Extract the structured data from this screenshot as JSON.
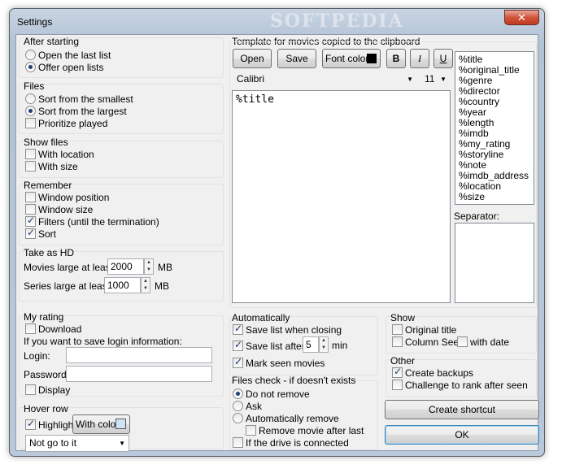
{
  "window": {
    "title": "Settings",
    "watermark": "SOFTPEDIA",
    "close_label": "✕"
  },
  "after_starting": {
    "title": "After starting",
    "options": [
      "Open the last list",
      "Offer open lists"
    ],
    "selected": "Offer open lists"
  },
  "files": {
    "title": "Files",
    "sort_smallest": "Sort from the smallest",
    "sort_largest": "Sort from the largest",
    "prioritize": "Prioritize played"
  },
  "show_files": {
    "title": "Show files",
    "with_location": "With location",
    "with_size": "With size"
  },
  "remember": {
    "title": "Remember",
    "window_position": "Window position",
    "window_size": "Window size",
    "filters": "Filters (until the termination)",
    "sort": "Sort"
  },
  "take_as_hd": {
    "title": "Take as HD",
    "movies_label": "Movies large at least",
    "movies_value": "2000",
    "movies_unit": "MB",
    "series_label": "Series large at least",
    "series_value": "1000",
    "series_unit": "MB"
  },
  "my_rating": {
    "title": "My rating",
    "download": "Download",
    "save_login_info": "If you want to save login information:",
    "login_label": "Login:",
    "login_value": "",
    "password_label": "Password:",
    "password_value": "",
    "display": "Display"
  },
  "hover_row": {
    "title": "Hover row",
    "highlight": "Highlight",
    "with_color": "With color",
    "select_value": "Not go to it"
  },
  "template": {
    "title": "Template for movies copied to the clipboard",
    "open_button": "Open",
    "save_button": "Save",
    "font_color_button": "Font color",
    "bold_button": "B",
    "italic_button": "I",
    "underline_button": "U",
    "font_name": "Calibri",
    "font_size": "11",
    "content": "%title",
    "tags": [
      "%title",
      "%original_title",
      "%genre",
      "%director",
      "%country",
      "%year",
      "%length",
      "%imdb",
      "%my_rating",
      "%storyline",
      "%note",
      "%imdb_address",
      "%location",
      "%size"
    ],
    "separator_label": "Separator:",
    "separator_value": ""
  },
  "automatically": {
    "title": "Automatically",
    "save_on_close": "Save list when closing",
    "save_after": "Save list after",
    "save_after_value": "5",
    "save_after_unit": "min",
    "mark_seen": "Mark seen movies"
  },
  "show": {
    "title": "Show",
    "original_title": "Original title",
    "column_seen": "Column Seen",
    "with_date": "with date"
  },
  "other": {
    "title": "Other",
    "create_backups": "Create backups",
    "challenge": "Challenge to rank after seen"
  },
  "files_check": {
    "title": "Files check - if doesn't exists",
    "do_not_remove": "Do not remove",
    "ask": "Ask",
    "auto_remove": "Automatically remove",
    "remove_after_last": "Remove movie after last",
    "if_drive_connected": "If the drive is connected"
  },
  "actions": {
    "create_shortcut": "Create shortcut",
    "ok": "OK"
  },
  "colors": {
    "font_color_swatch": "#000000",
    "highlight_color_swatch": "#cfe3f7"
  }
}
